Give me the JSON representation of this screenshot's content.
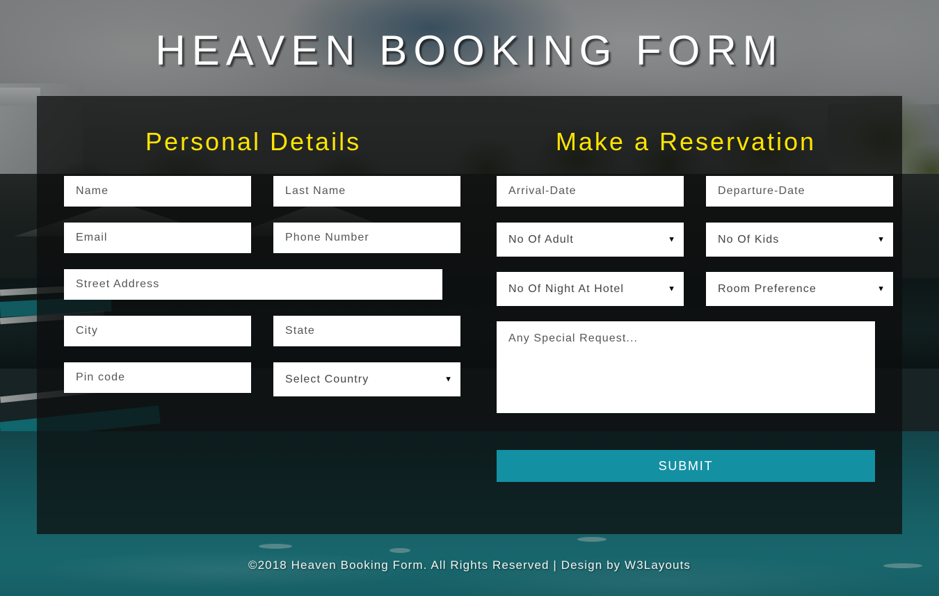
{
  "page": {
    "title": "HEAVEN BOOKING FORM"
  },
  "personal": {
    "heading": "Personal Details",
    "name_placeholder": "Name",
    "last_name_placeholder": "Last Name",
    "email_placeholder": "Email",
    "phone_placeholder": "Phone Number",
    "street_placeholder": "Street Address",
    "city_placeholder": "City",
    "state_placeholder": "State",
    "pin_placeholder": "Pin code",
    "country_selected": "Select Country"
  },
  "reservation": {
    "heading": "Make a Reservation",
    "arrival_placeholder": "Arrival-Date",
    "departure_placeholder": "Departure-Date",
    "adults_selected": "No Of Adult",
    "kids_selected": "No Of Kids",
    "nights_selected": "No Of Night At Hotel",
    "room_selected": "Room Preference",
    "request_placeholder": "Any Special Request...",
    "submit_label": "SUBMIT"
  },
  "icons": {
    "dropdown_arrow": "▼"
  },
  "footer": {
    "text": "©2018 Heaven Booking Form. All Rights Reserved | Design by W3Layouts"
  },
  "colors": {
    "heading_yellow": "#ffe400",
    "submit_teal": "#1490a3",
    "panel_overlay": "rgba(12,14,14,0.74)",
    "field_white": "#ffffff",
    "title_white": "#ffffff"
  }
}
